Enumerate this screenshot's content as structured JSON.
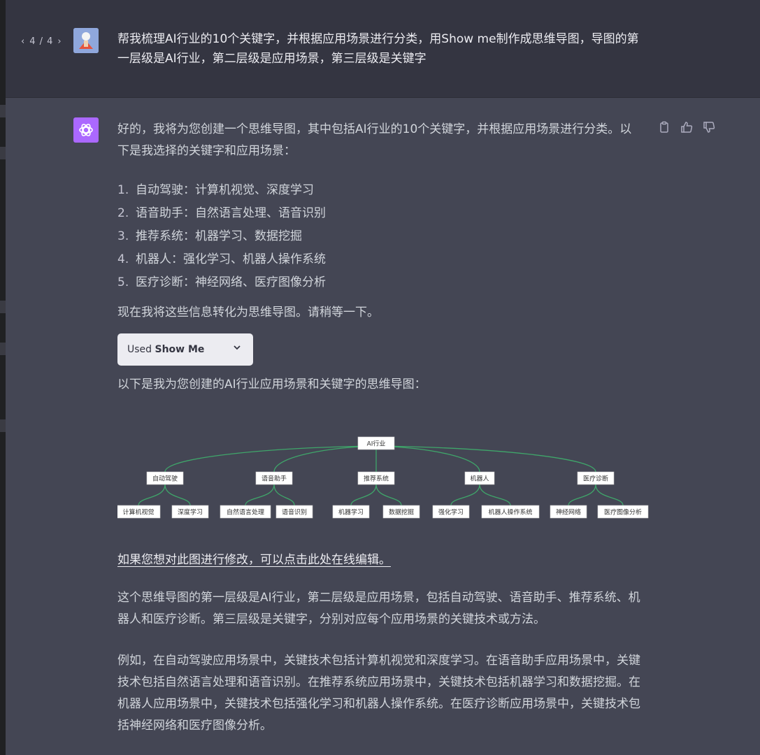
{
  "pager": {
    "prev": "‹",
    "label": "4 / 4",
    "next": "›"
  },
  "user_message": "帮我梳理AI行业的10个关键字，并根据应用场景进行分类，用Show me制作成思维导图，导图的第一层级是AI行业，第二层级是应用场景，第三层级是关键字",
  "assistant": {
    "intro": "好的，我将为您创建一个思维导图，其中包括AI行业的10个关键字，并根据应用场景进行分类。以下是我选择的关键字和应用场景：",
    "list": [
      {
        "num": "1.",
        "text": "自动驾驶：计算机视觉、深度学习"
      },
      {
        "num": "2.",
        "text": "语音助手：自然语言处理、语音识别"
      },
      {
        "num": "3.",
        "text": "推荐系统：机器学习、数据挖掘"
      },
      {
        "num": "4.",
        "text": "机器人：强化学习、机器人操作系统"
      },
      {
        "num": "5.",
        "text": "医疗诊断：神经网络、医疗图像分析"
      }
    ],
    "now": "现在我将这些信息转化为思维导图。请稍等一下。",
    "used_prefix": "Used",
    "used_plugin": "Show Me",
    "below": "以下是我为您创建的AI行业应用场景和关键字的思维导图：",
    "link": "如果您想对此图进行修改，可以点击此处在线编辑。",
    "para2": "这个思维导图的第一层级是AI行业，第二层级是应用场景，包括自动驾驶、语音助手、推荐系统、机器人和医疗诊断。第三层级是关键字，分别对应每个应用场景的关键技术或方法。",
    "para3": "例如，在自动驾驶应用场景中，关键技术包括计算机视觉和深度学习。在语音助手应用场景中，关键技术包括自然语言处理和语音识别。在推荐系统应用场景中，关键技术包括机器学习和数据挖掘。在机器人应用场景中，关键技术包括强化学习和机器人操作系统。在医疗诊断应用场景中，关键技术包括神经网络和医疗图像分析。"
  },
  "mindmap": {
    "root": "AI行业",
    "branches": [
      {
        "label": "自动驾驶",
        "children": [
          "计算机视觉",
          "深度学习"
        ]
      },
      {
        "label": "语音助手",
        "children": [
          "自然语言处理",
          "语音识别"
        ]
      },
      {
        "label": "推荐系统",
        "children": [
          "机器学习",
          "数据挖掘"
        ]
      },
      {
        "label": "机器人",
        "children": [
          "强化学习",
          "机器人操作系统"
        ]
      },
      {
        "label": "医疗诊断",
        "children": [
          "神经网络",
          "医疗图像分析"
        ]
      }
    ]
  },
  "colors": {
    "link_line": "#3fa66a",
    "node_bg": "#ffffff",
    "bot_avatar": "#ab68ff"
  },
  "icons": [
    "chevron-left-icon",
    "chevron-right-icon",
    "chevron-down-icon",
    "copy-icon",
    "thumbs-up-icon",
    "thumbs-down-icon",
    "openai-logo-icon"
  ]
}
